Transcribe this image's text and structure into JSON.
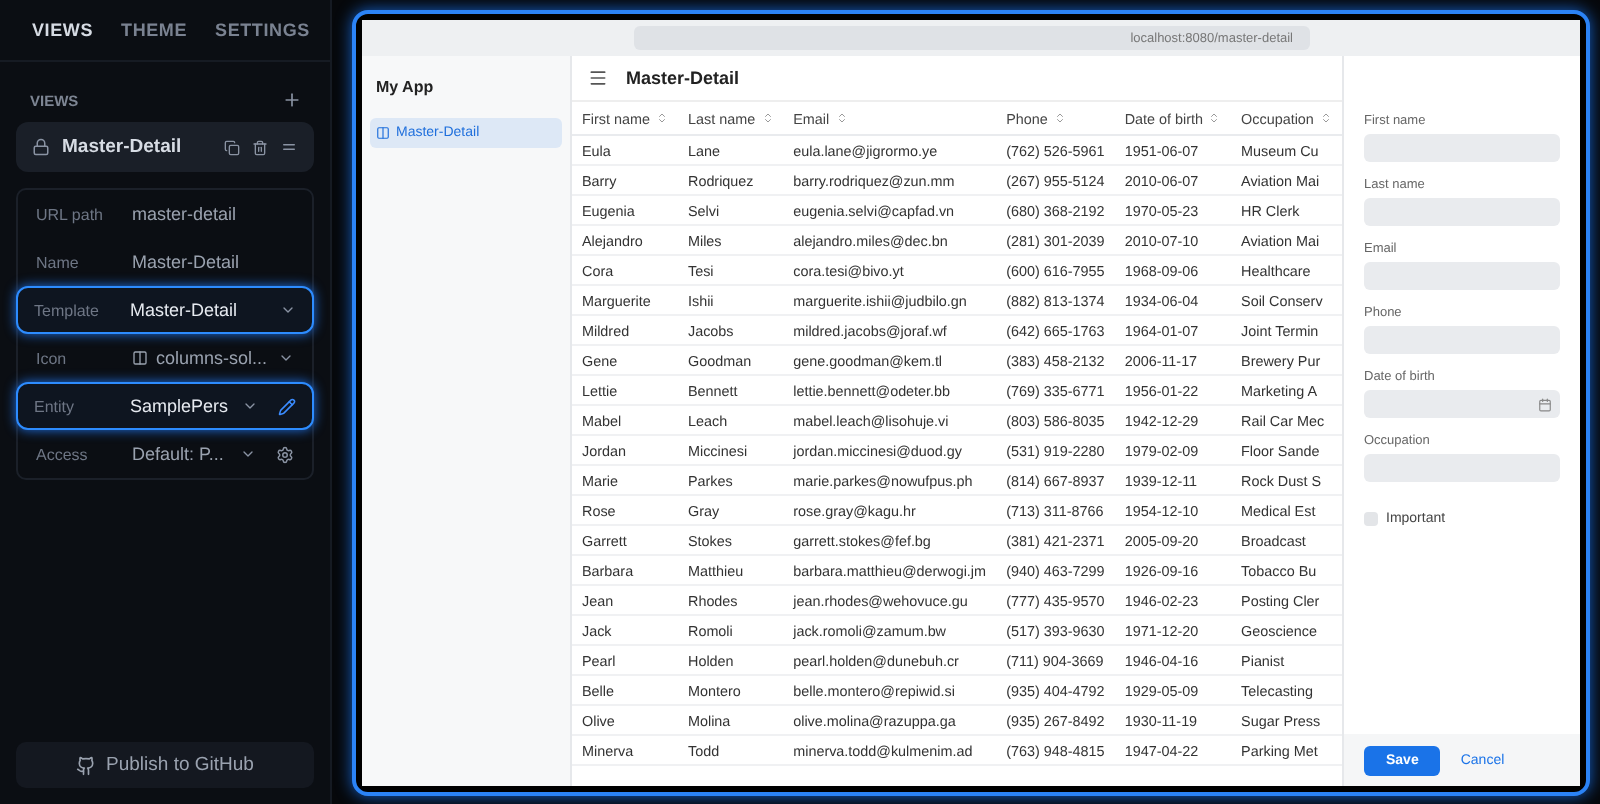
{
  "panel_tabs": [
    {
      "label": "VIEWS",
      "selected": true
    },
    {
      "label": "THEME",
      "selected": false
    },
    {
      "label": "SETTINGS",
      "selected": false
    }
  ],
  "views_section": {
    "title": "VIEWS"
  },
  "views": [
    {
      "name": "Master-Detail",
      "selected": true
    }
  ],
  "properties": [
    {
      "label": "URL path",
      "value": "master-detail",
      "kind": "text",
      "highlighted": false
    },
    {
      "label": "Name",
      "value": "Master-Detail",
      "kind": "text",
      "highlighted": false
    },
    {
      "label": "Template",
      "value": "Master-Detail",
      "kind": "select",
      "highlighted": true
    },
    {
      "label": "Icon",
      "value": "columns-sol...",
      "kind": "icon-select",
      "highlighted": false
    },
    {
      "label": "Entity",
      "value": "SamplePers",
      "kind": "select-edit",
      "highlighted": true
    },
    {
      "label": "Access",
      "value": "Default: P...",
      "kind": "select-settings",
      "highlighted": false
    }
  ],
  "publish_button": "Publish to GitHub",
  "preview": {
    "url": "localhost:8080/master-detail",
    "app_title": "My App",
    "nav": [
      {
        "label": "Master-Detail",
        "selected": true
      }
    ],
    "page_title": "Master-Detail",
    "table": {
      "columns": [
        "First name",
        "Last name",
        "Email",
        "Phone",
        "Date of birth",
        "Occupation"
      ],
      "rows": [
        [
          "Eula",
          "Lane",
          "eula.lane@jigrormo.ye",
          "(762) 526-5961",
          "1951-06-07",
          "Museum Cu"
        ],
        [
          "Barry",
          "Rodriquez",
          "barry.rodriquez@zun.mm",
          "(267) 955-5124",
          "2010-06-07",
          "Aviation Mai"
        ],
        [
          "Eugenia",
          "Selvi",
          "eugenia.selvi@capfad.vn",
          "(680) 368-2192",
          "1970-05-23",
          "HR Clerk"
        ],
        [
          "Alejandro",
          "Miles",
          "alejandro.miles@dec.bn",
          "(281) 301-2039",
          "2010-07-10",
          "Aviation Mai"
        ],
        [
          "Cora",
          "Tesi",
          "cora.tesi@bivo.yt",
          "(600) 616-7955",
          "1968-09-06",
          "Healthcare"
        ],
        [
          "Marguerite",
          "Ishii",
          "marguerite.ishii@judbilo.gn",
          "(882) 813-1374",
          "1934-06-04",
          "Soil Conserv"
        ],
        [
          "Mildred",
          "Jacobs",
          "mildred.jacobs@joraf.wf",
          "(642) 665-1763",
          "1964-01-07",
          "Joint Termin"
        ],
        [
          "Gene",
          "Goodman",
          "gene.goodman@kem.tl",
          "(383) 458-2132",
          "2006-11-17",
          "Brewery Pur"
        ],
        [
          "Lettie",
          "Bennett",
          "lettie.bennett@odeter.bb",
          "(769) 335-6771",
          "1956-01-22",
          "Marketing A"
        ],
        [
          "Mabel",
          "Leach",
          "mabel.leach@lisohuje.vi",
          "(803) 586-8035",
          "1942-12-29",
          "Rail Car Mec"
        ],
        [
          "Jordan",
          "Miccinesi",
          "jordan.miccinesi@duod.gy",
          "(531) 919-2280",
          "1979-02-09",
          "Floor Sande"
        ],
        [
          "Marie",
          "Parkes",
          "marie.parkes@nowufpus.ph",
          "(814) 667-8937",
          "1939-12-11",
          "Rock Dust S"
        ],
        [
          "Rose",
          "Gray",
          "rose.gray@kagu.hr",
          "(713) 311-8766",
          "1954-12-10",
          "Medical Est"
        ],
        [
          "Garrett",
          "Stokes",
          "garrett.stokes@fef.bg",
          "(381) 421-2371",
          "2005-09-20",
          "Broadcast"
        ],
        [
          "Barbara",
          "Matthieu",
          "barbara.matthieu@derwogi.jm",
          "(940) 463-7299",
          "1926-09-16",
          "Tobacco Bu"
        ],
        [
          "Jean",
          "Rhodes",
          "jean.rhodes@wehovuce.gu",
          "(777) 435-9570",
          "1946-02-23",
          "Posting Cler"
        ],
        [
          "Jack",
          "Romoli",
          "jack.romoli@zamum.bw",
          "(517) 393-9630",
          "1971-12-20",
          "Geoscience"
        ],
        [
          "Pearl",
          "Holden",
          "pearl.holden@dunebuh.cr",
          "(711) 904-3669",
          "1946-04-16",
          "Pianist"
        ],
        [
          "Belle",
          "Montero",
          "belle.montero@repiwid.si",
          "(935) 404-4792",
          "1929-05-09",
          "Telecasting"
        ],
        [
          "Olive",
          "Molina",
          "olive.molina@razuppa.ga",
          "(935) 267-8492",
          "1930-11-19",
          "Sugar Press"
        ],
        [
          "Minerva",
          "Todd",
          "minerva.todd@kulmenim.ad",
          "(763) 948-4815",
          "1947-04-22",
          "Parking Met"
        ]
      ]
    },
    "form": {
      "fields": [
        {
          "label": "First name",
          "kind": "text"
        },
        {
          "label": "Last name",
          "kind": "text"
        },
        {
          "label": "Email",
          "kind": "text"
        },
        {
          "label": "Phone",
          "kind": "text"
        },
        {
          "label": "Date of birth",
          "kind": "date"
        },
        {
          "label": "Occupation",
          "kind": "text"
        }
      ],
      "checkbox": {
        "label": "Important",
        "checked": false
      },
      "save": "Save",
      "cancel": "Cancel"
    }
  }
}
